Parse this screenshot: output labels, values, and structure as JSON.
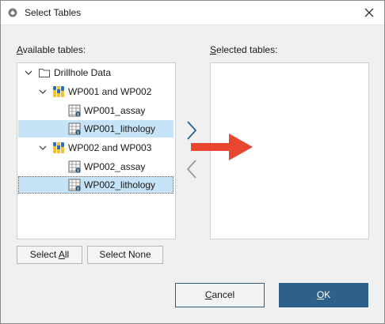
{
  "window": {
    "title": "Select Tables",
    "icon": "leapfrog-app-icon",
    "close_icon": "close-icon"
  },
  "available": {
    "label_mnemonic": "A",
    "label_rest": "vailable tables:",
    "tree": {
      "root": {
        "label": "Drillhole Data",
        "expanded": true,
        "icon": "folder-icon"
      },
      "groups": [
        {
          "label": "WP001 and WP002",
          "expanded": true,
          "icon": "drillhole-group-icon",
          "items": [
            {
              "label": "WP001_assay",
              "selected": false,
              "icon": "table-icon"
            },
            {
              "label": "WP001_lithology",
              "selected": true,
              "icon": "table-icon"
            }
          ]
        },
        {
          "label": "WP002 and WP003",
          "expanded": true,
          "icon": "drillhole-group-icon",
          "items": [
            {
              "label": "WP002_assay",
              "selected": false,
              "icon": "table-icon"
            },
            {
              "label": "WP002_lithology",
              "selected": true,
              "focused": true,
              "icon": "table-icon"
            }
          ]
        }
      ]
    }
  },
  "selected": {
    "label_mnemonic": "S",
    "label_rest": "elected tables:",
    "items": []
  },
  "transfer": {
    "add_icon": "chevron-right-icon",
    "remove_icon": "chevron-left-icon"
  },
  "annotation": {
    "icon": "red-arrow-icon",
    "color": "#e8462f"
  },
  "buttons": {
    "select_all_pre": "Select ",
    "select_all_mnemonic": "A",
    "select_all_post": "ll",
    "select_none": "Select None",
    "cancel_mnemonic": "C",
    "cancel_rest": "ancel",
    "ok_mnemonic": "O",
    "ok_rest": "K"
  },
  "colors": {
    "accent": "#2e6189",
    "selection": "#c7e3f7",
    "arrow": "#e8462f"
  }
}
